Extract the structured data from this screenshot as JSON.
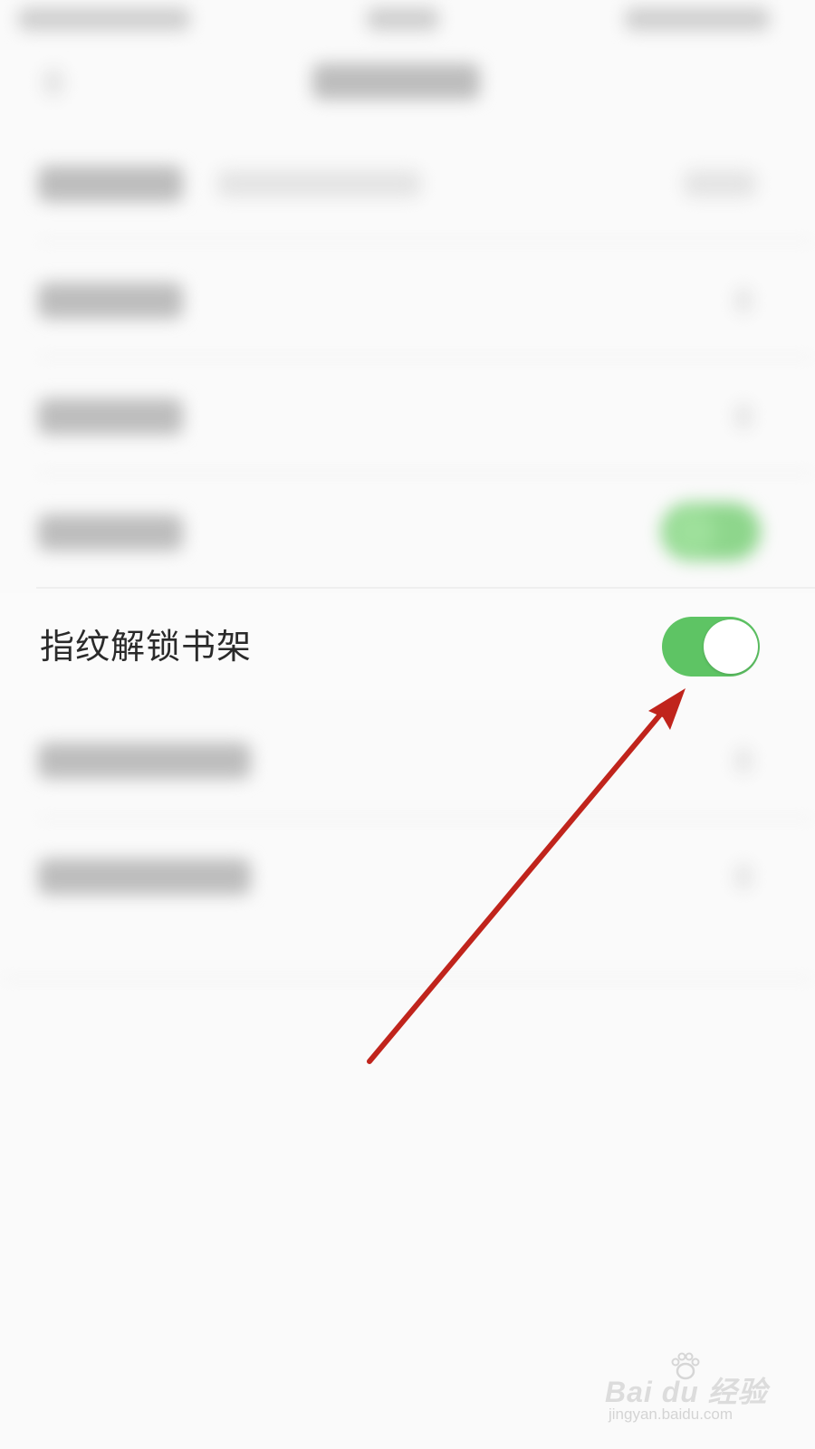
{
  "fingerprint_row": {
    "label": "指纹解锁书架",
    "toggle_on": true
  },
  "colors": {
    "toggle_on": "#5ec464",
    "arrow": "#c0241c",
    "background": "#fafafa"
  },
  "watermark": {
    "brand": "Bai du 经验",
    "url": "jingyan.baidu.com"
  }
}
